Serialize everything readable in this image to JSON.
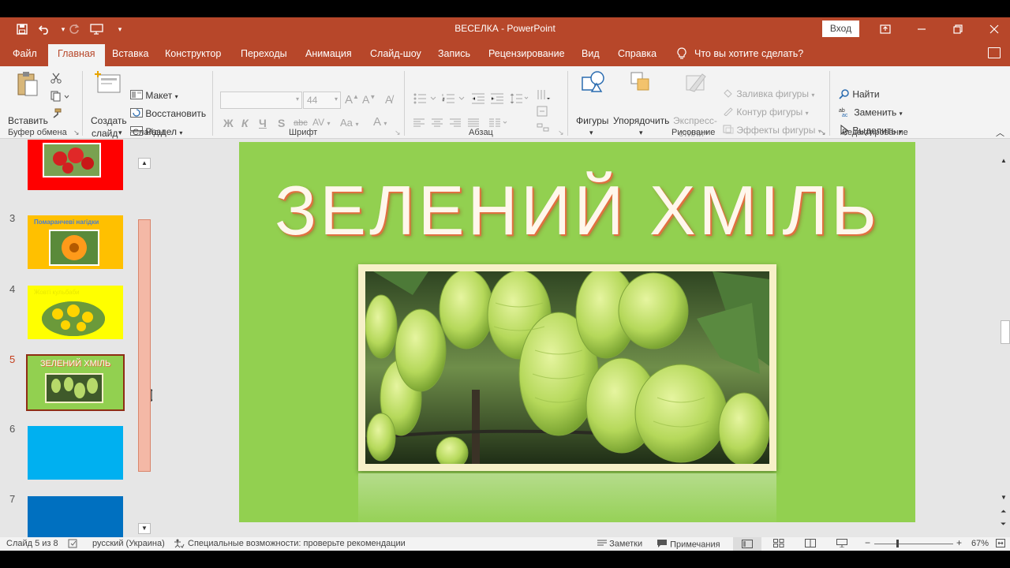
{
  "window": {
    "title": "ВЕСЕЛКА  -  PowerPoint",
    "signin_label": "Вход"
  },
  "menu": {
    "tabs": [
      "Файл",
      "Главная",
      "Вставка",
      "Конструктор",
      "Переходы",
      "Анимация",
      "Слайд-шоу",
      "Запись",
      "Рецензирование",
      "Вид",
      "Справка"
    ],
    "active_tab": "Главная",
    "tell_me": "Что вы хотите сделать?"
  },
  "ribbon": {
    "clipboard": {
      "label": "Буфер обмена",
      "paste": "Вставить"
    },
    "slides": {
      "label": "Слайды",
      "new_slide_line1": "Создать",
      "new_slide_line2": "слайд",
      "layout": "Макет",
      "reset": "Восстановить",
      "section": "Раздел"
    },
    "font": {
      "label": "Шрифт",
      "size": "44",
      "bold": "Ж",
      "italic": "К",
      "underline": "Ч",
      "shadow": "S",
      "strike": "abc",
      "spacing": "AV",
      "case": "Aa"
    },
    "paragraph": {
      "label": "Абзац"
    },
    "drawing": {
      "label": "Рисование",
      "shapes": "Фигуры",
      "arrange": "Упорядочить",
      "quick_styles_line1": "Экспресс-",
      "quick_styles_line2": "стили",
      "shape_fill": "Заливка фигуры",
      "shape_outline": "Контур фигуры",
      "shape_effects": "Эффекты фигуры"
    },
    "editing": {
      "label": "Редактирование",
      "find": "Найти",
      "replace": "Заменить",
      "select": "Выделить"
    }
  },
  "thumbnails": [
    {
      "num": "",
      "bg": "#ff0000",
      "caption": ""
    },
    {
      "num": "3",
      "bg": "#ffc000",
      "caption": "Помаранчеві нагідки"
    },
    {
      "num": "4",
      "bg": "#ffff00",
      "caption": "Жовті кульбаби"
    },
    {
      "num": "5",
      "bg": "#92d050",
      "caption": "ЗЕЛЕНИЙ ХМІЛЬ"
    },
    {
      "num": "6",
      "bg": "#00b0f0",
      "caption": ""
    },
    {
      "num": "7",
      "bg": "#0070c0",
      "caption": ""
    }
  ],
  "selected_thumbnail": "5",
  "slide": {
    "title": "ЗЕЛЕНИЙ ХМІЛЬ",
    "background": "#92d050"
  },
  "status": {
    "slide_counter": "Слайд 5 из 8",
    "language": "русский (Украина)",
    "accessibility": "Специальные возможности: проверьте рекомендации",
    "notes": "Заметки",
    "comments": "Примечания",
    "zoom": "67%"
  },
  "colors": {
    "accent": "#b7472a"
  }
}
